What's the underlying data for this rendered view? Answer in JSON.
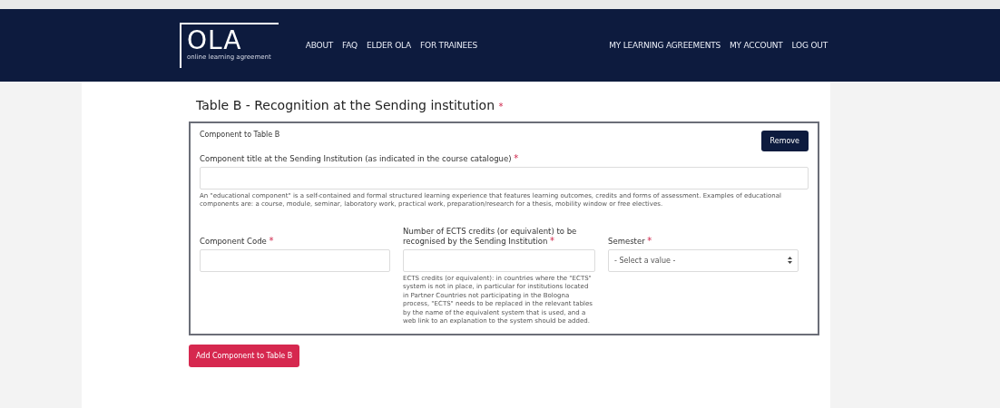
{
  "header": {
    "logo": {
      "text": "OLA",
      "tagline": "online learning agreement"
    },
    "nav_left": [
      "ABOUT",
      "FAQ",
      "ELDER OLA",
      "FOR TRAINEES"
    ],
    "nav_right": [
      "MY LEARNING AGREEMENTS",
      "MY ACCOUNT",
      "LOG OUT"
    ]
  },
  "section": {
    "title": "Table B - Recognition at the Sending institution",
    "required": "*"
  },
  "component": {
    "heading": "Component to Table B",
    "remove_button": "Remove",
    "title_field": {
      "label": "Component title at the Sending Institution (as indicated in the course catalogue)",
      "required": "*",
      "help": "An \"educational component\" is a self-contained and formal structured learning experience that features learning outcomes, credits and forms of assessment. Examples of educational components are: a course, module, seminar, laboratory work, practical work, preparation/research for a thesis, mobility window or free electives."
    },
    "fields": [
      {
        "kind": "text",
        "label": "Component Code",
        "required": "*"
      },
      {
        "kind": "text",
        "label": "Number of ECTS credits (or equivalent) to be recognised by the Sending Institution",
        "required": "*",
        "help": "ECTS credits (or equivalent): in countries where the \"ECTS\" system is not in place, in particular for institutions located in Partner Countries not participating in the Bologna process, \"ECTS\" needs to be replaced in the relevant tables by the name of the equivalent system that is used, and a web link to an explanation to the system should be added."
      },
      {
        "kind": "select",
        "label": "Semester",
        "required": "*",
        "placeholder": "- Select a value -"
      }
    ]
  },
  "add_button": "Add Component to Table B"
}
